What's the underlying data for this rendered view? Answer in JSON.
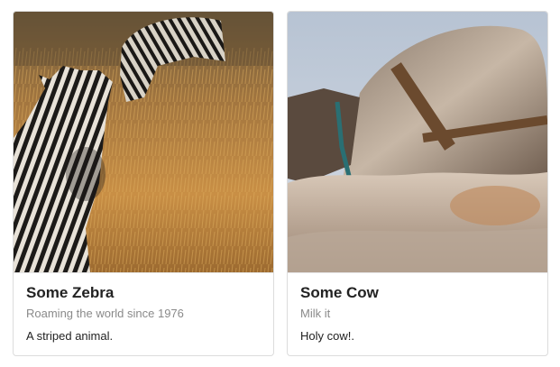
{
  "cards": [
    {
      "title": "Some Zebra",
      "subtitle": "Roaming the world since 1976",
      "text": "A striped animal.",
      "image_subject": "zebra"
    },
    {
      "title": "Some Cow",
      "subtitle": "Milk it",
      "text": "Holy cow!.",
      "image_subject": "cow"
    }
  ],
  "colors": {
    "card_border": "#dcdcdc",
    "title": "#222222",
    "subtitle": "#8a8a8a"
  }
}
